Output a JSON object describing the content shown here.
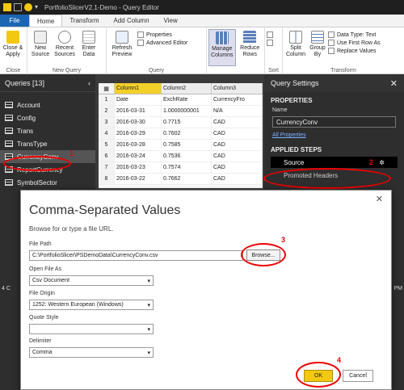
{
  "window": {
    "title": "PortfolioSlicerV2.1-Demo - Query Editor"
  },
  "tabs": [
    "File",
    "Home",
    "Transform",
    "Add Column",
    "View"
  ],
  "ribbon": {
    "close_apply": "Close & Apply",
    "new_source": "New Source",
    "recent_sources": "Recent Sources",
    "enter_data": "Enter Data",
    "refresh_preview": "Refresh Preview",
    "properties": "Properties",
    "advanced_editor": "Advanced Editor",
    "manage_columns": "Manage Columns",
    "reduce_rows": "Reduce Rows",
    "split_column": "Split Column",
    "group_by": "Group By",
    "data_type": "Data Type: Text",
    "use_first_row": "Use First Row As",
    "replace_values": "Replace Values",
    "groups": {
      "close": "Close",
      "new_query": "New Query",
      "query": "Query",
      "sort": "Sort",
      "transform": "Transform"
    }
  },
  "queries": {
    "header": "Queries [13]",
    "items": [
      "Account",
      "Config",
      "Trans",
      "TransType",
      "CurrencyConv",
      "ReportCurrency",
      "SymbolSector"
    ]
  },
  "grid": {
    "headers": [
      "Column1",
      "Column2",
      "Column3"
    ],
    "rows": [
      [
        "1",
        "Date",
        "ExchRate",
        "CurrencyFro"
      ],
      [
        "2",
        "2016-03-31",
        "1.0000000001",
        "N/A"
      ],
      [
        "3",
        "2016-03-30",
        "0.7715",
        "CAD"
      ],
      [
        "4",
        "2016-03-29",
        "0.7602",
        "CAD"
      ],
      [
        "5",
        "2016-03-28",
        "0.7585",
        "CAD"
      ],
      [
        "6",
        "2016-03-24",
        "0.7536",
        "CAD"
      ],
      [
        "7",
        "2016-03-23",
        "0.7574",
        "CAD"
      ],
      [
        "8",
        "2016-03-22",
        "0.7662",
        "CAD"
      ]
    ]
  },
  "settings": {
    "header": "Query Settings",
    "properties_label": "PROPERTIES",
    "name_label": "Name",
    "name_value": "CurrencyConv",
    "all_properties": "All Properties",
    "applied_steps_label": "APPLIED STEPS",
    "steps": [
      "Source",
      "Promoted Headers"
    ]
  },
  "dialog": {
    "title": "Comma-Separated Values",
    "subtitle": "Browse for or type a file URL.",
    "file_path_label": "File Path",
    "file_path_value": "C:\\PortfolioSlicer\\PSDemoData\\CurrencyConv.csv",
    "browse": "Browse...",
    "open_file_as_label": "Open File As",
    "open_file_as_value": "Csv Document",
    "file_origin_label": "File Origin",
    "file_origin_value": "1252: Western European (Windows)",
    "quote_style_label": "Quote Style",
    "quote_style_value": "",
    "delimiter_label": "Delimiter",
    "delimiter_value": "Comma",
    "ok": "OK",
    "cancel": "Cancel"
  },
  "annotations": [
    "1",
    "2",
    "3",
    "4"
  ],
  "status_fragments": {
    "left": "4 C",
    "right": "PM"
  },
  "colors": {
    "file_tab": "#1a66b3",
    "ok_button": "#f2c811",
    "annotation": "#e00000",
    "column1_header": "#f4cf2a"
  }
}
